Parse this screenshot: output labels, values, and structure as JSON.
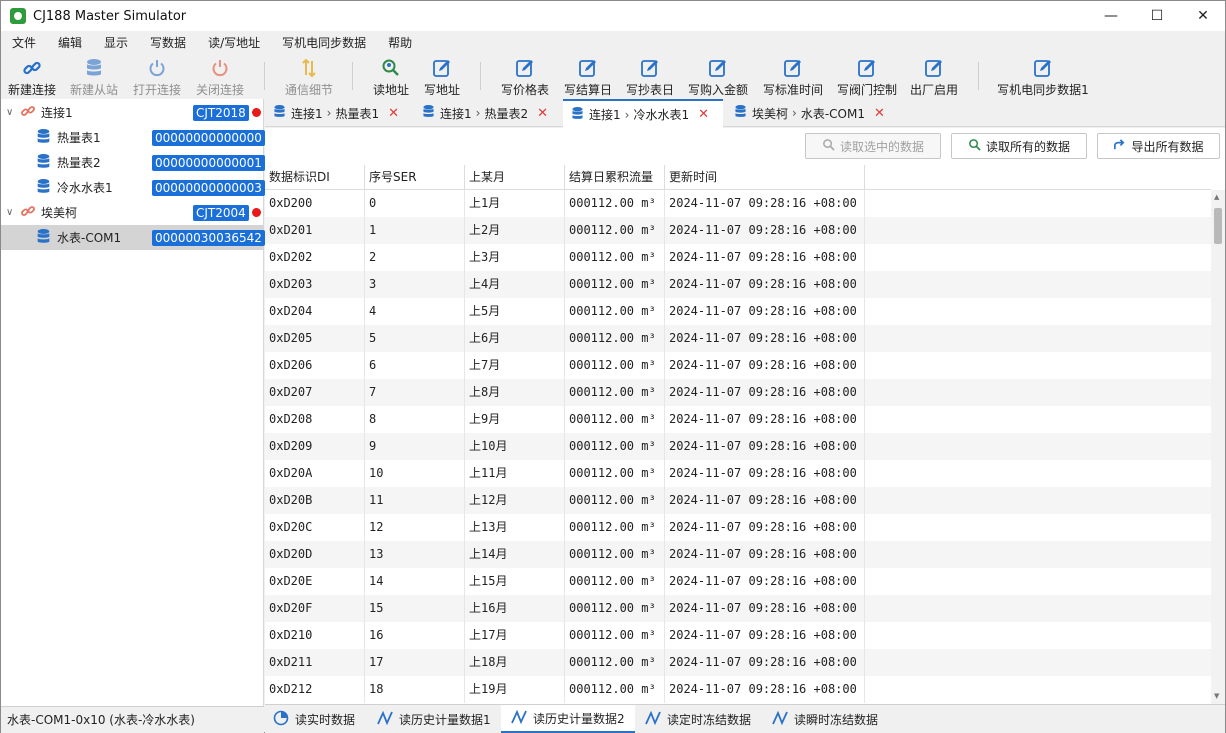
{
  "window": {
    "title": "CJ188 Master Simulator",
    "minimize": "—",
    "maximize": "☐",
    "close": "✕"
  },
  "menu": [
    "文件",
    "编辑",
    "显示",
    "写数据",
    "读/写地址",
    "写机电同步数据",
    "帮助"
  ],
  "toolbar": {
    "new_connection": "新建连接",
    "new_slave": "新建从站",
    "open_connection": "打开连接",
    "close_connection": "关闭连接",
    "comm_detail": "通信细节",
    "read_address": "读地址",
    "write_address": "写地址",
    "write_price": "写价格表",
    "write_settle_day": "写结算日",
    "write_read_day": "写抄表日",
    "write_purchase": "写购入金额",
    "write_std_time": "写标准时间",
    "write_valve": "写阀门控制",
    "factory_enable": "出厂启用",
    "write_sync": "写机电同步数据1"
  },
  "tree": {
    "conn1": {
      "label": "连接1",
      "badge": "CJT2018"
    },
    "conn1_children": [
      {
        "label": "热量表1",
        "addr": "00000000000000"
      },
      {
        "label": "热量表2",
        "addr": "00000000000001"
      },
      {
        "label": "冷水水表1",
        "addr": "00000000000003"
      }
    ],
    "conn2": {
      "label": "埃美柯",
      "badge": "CJT2004"
    },
    "conn2_children": [
      {
        "label": "水表-COM1",
        "addr": "00000030036542"
      }
    ]
  },
  "status_left": "水表-COM1-0x10 (水表-冷水水表)",
  "tabs": [
    {
      "conn": "连接1",
      "dev": "热量表1"
    },
    {
      "conn": "连接1",
      "dev": "热量表2"
    },
    {
      "conn": "连接1",
      "dev": "冷水水表1"
    },
    {
      "conn": "埃美柯",
      "dev": "水表-COM1"
    }
  ],
  "tab_close": "✕",
  "actions": {
    "read_selected": "读取选中的数据",
    "read_all": "读取所有的数据",
    "export_all": "导出所有数据"
  },
  "table": {
    "headers": [
      "数据标识DI",
      "序号SER",
      "上某月",
      "结算日累积流量",
      "更新时间"
    ],
    "rows": [
      [
        "0xD200",
        "0",
        "上1月",
        "000112.00 m³",
        "2024-11-07 09:28:16 +08:00"
      ],
      [
        "0xD201",
        "1",
        "上2月",
        "000112.00 m³",
        "2024-11-07 09:28:16 +08:00"
      ],
      [
        "0xD202",
        "2",
        "上3月",
        "000112.00 m³",
        "2024-11-07 09:28:16 +08:00"
      ],
      [
        "0xD203",
        "3",
        "上4月",
        "000112.00 m³",
        "2024-11-07 09:28:16 +08:00"
      ],
      [
        "0xD204",
        "4",
        "上5月",
        "000112.00 m³",
        "2024-11-07 09:28:16 +08:00"
      ],
      [
        "0xD205",
        "5",
        "上6月",
        "000112.00 m³",
        "2024-11-07 09:28:16 +08:00"
      ],
      [
        "0xD206",
        "6",
        "上7月",
        "000112.00 m³",
        "2024-11-07 09:28:16 +08:00"
      ],
      [
        "0xD207",
        "7",
        "上8月",
        "000112.00 m³",
        "2024-11-07 09:28:16 +08:00"
      ],
      [
        "0xD208",
        "8",
        "上9月",
        "000112.00 m³",
        "2024-11-07 09:28:16 +08:00"
      ],
      [
        "0xD209",
        "9",
        "上10月",
        "000112.00 m³",
        "2024-11-07 09:28:16 +08:00"
      ],
      [
        "0xD20A",
        "10",
        "上11月",
        "000112.00 m³",
        "2024-11-07 09:28:16 +08:00"
      ],
      [
        "0xD20B",
        "11",
        "上12月",
        "000112.00 m³",
        "2024-11-07 09:28:16 +08:00"
      ],
      [
        "0xD20C",
        "12",
        "上13月",
        "000112.00 m³",
        "2024-11-07 09:28:16 +08:00"
      ],
      [
        "0xD20D",
        "13",
        "上14月",
        "000112.00 m³",
        "2024-11-07 09:28:16 +08:00"
      ],
      [
        "0xD20E",
        "14",
        "上15月",
        "000112.00 m³",
        "2024-11-07 09:28:16 +08:00"
      ],
      [
        "0xD20F",
        "15",
        "上16月",
        "000112.00 m³",
        "2024-11-07 09:28:16 +08:00"
      ],
      [
        "0xD210",
        "16",
        "上17月",
        "000112.00 m³",
        "2024-11-07 09:28:16 +08:00"
      ],
      [
        "0xD211",
        "17",
        "上18月",
        "000112.00 m³",
        "2024-11-07 09:28:16 +08:00"
      ],
      [
        "0xD212",
        "18",
        "上19月",
        "000112.00 m³",
        "2024-11-07 09:28:16 +08:00"
      ]
    ]
  },
  "bottom_tabs": [
    "读实时数据",
    "读历史计量数据1",
    "读历史计量数据2",
    "读定时冻结数据",
    "读瞬时冻结数据"
  ],
  "colors": {
    "accent": "#2a72c8",
    "badge": "#1a6fd9",
    "status_dot": "#e81a1a",
    "close": "#e23a3a"
  }
}
